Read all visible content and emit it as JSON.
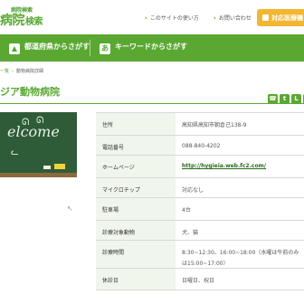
{
  "header": {
    "logo_sub": "病院検索",
    "logo_main": "病院",
    "logo_tail": "検索",
    "links": [
      {
        "label": "このサイトの使い方"
      },
      {
        "label": "お問い合わせ"
      }
    ],
    "cta_label": "対応医療機"
  },
  "nav": {
    "items": [
      {
        "icon": "map-icon",
        "label": "都道府県からさがす"
      },
      {
        "icon": "keyword-icon",
        "icon_glyph": "あ",
        "label": "キーワードからさがす"
      }
    ]
  },
  "breadcrumb": {
    "home": "一覧",
    "current": "動物病院詳細"
  },
  "page": {
    "title": "ジア動物病院",
    "share_icons": [
      "phone-icon",
      "twitter-icon",
      "line-icon",
      "mail-icon"
    ]
  },
  "photo": {
    "chalk_text": "elcome"
  },
  "details": {
    "rows": [
      {
        "label": "住所",
        "value": "高知県高知市朝倉己138-9"
      },
      {
        "label": "電話番号",
        "value": "088-840-4202"
      },
      {
        "label": "ホームページ",
        "value": "http://hygieia.web.fc2.com/",
        "is_link": true
      },
      {
        "label": "マイクロチップ",
        "value": "対応なし"
      },
      {
        "label": "駐車場",
        "value": "4台"
      },
      {
        "label": "診療対象動物",
        "value": "犬、猫"
      },
      {
        "label": "診療時間",
        "value": "8:30~12:30、16:00~18:00（水曜は午前のみ",
        "value2": "は15:00~17:00）"
      },
      {
        "label": "休診日",
        "value": "日曜日、祝日"
      }
    ]
  },
  "colors": {
    "brand_green": "#5aa832",
    "cta_yellow": "#f2b630",
    "label_bg": "#f1f6ec"
  }
}
